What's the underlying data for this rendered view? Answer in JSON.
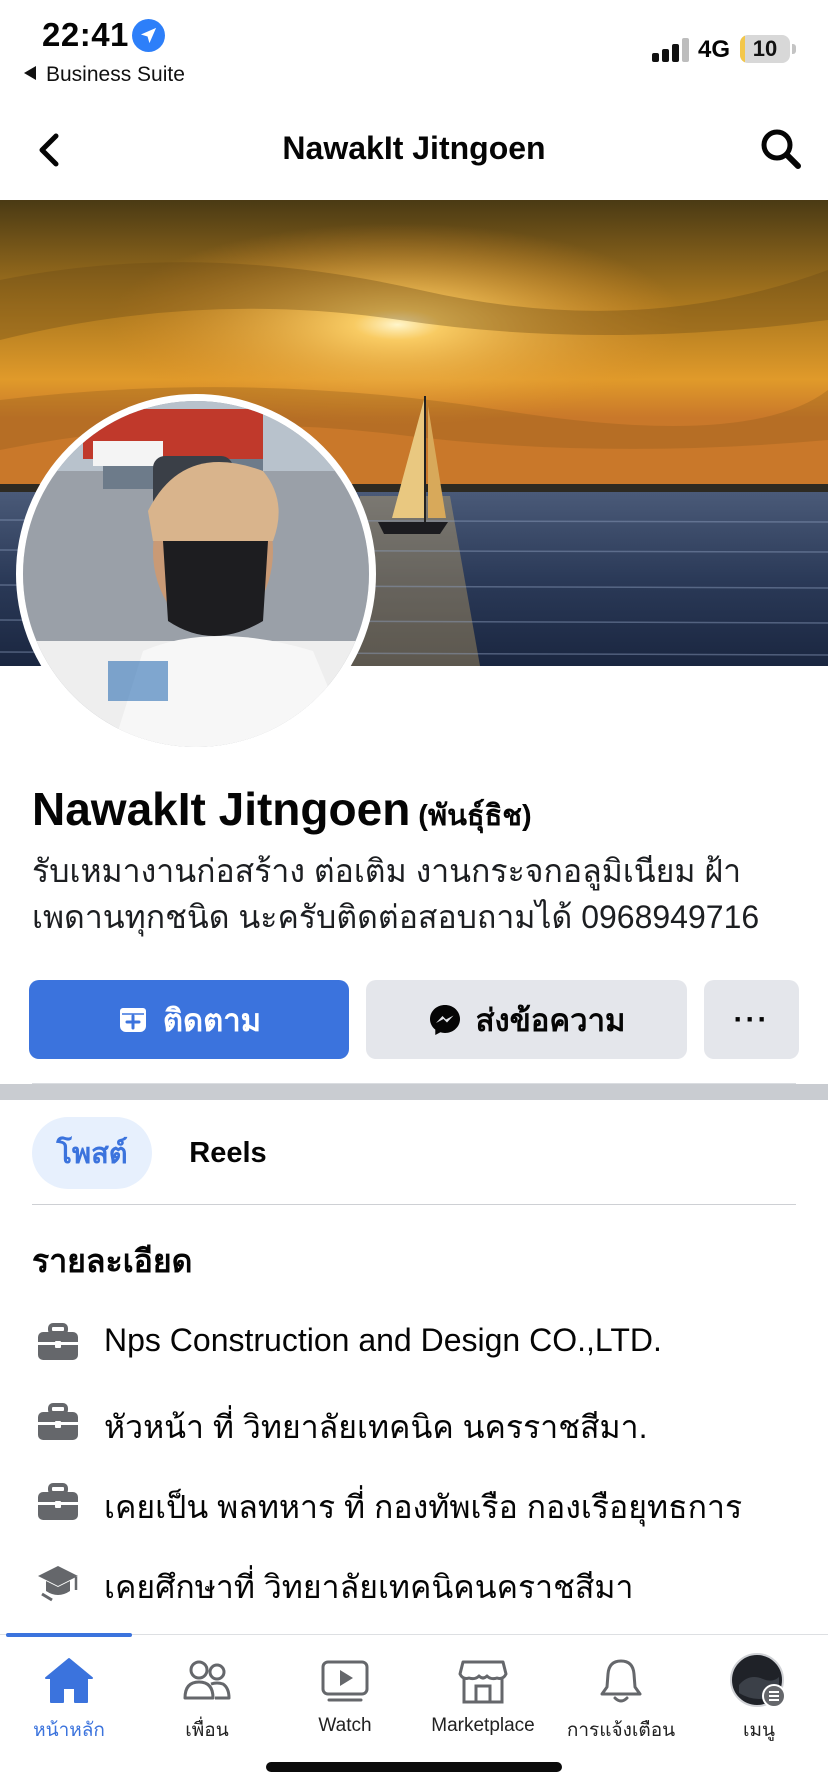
{
  "status_bar": {
    "time": "22:41",
    "back_app": "Business Suite",
    "network": "4G",
    "battery": "10",
    "battery_level": 0.1
  },
  "nav": {
    "title": "NawakIt Jitngoen"
  },
  "profile": {
    "name": "NawakIt Jitngoen",
    "alt_name": "(พันธุ์ธิช)",
    "bio_line1": "รับเหมางานก่อสร้าง ต่อเติม งานกระจกอลูมิเนียม ฝ้า",
    "bio_line2": "เพดานทุกชนิด นะครับติดต่อสอบถามได้ 0968949716"
  },
  "actions": {
    "follow": "ติดตาม",
    "message": "ส่งข้อความ",
    "more": "···"
  },
  "tabs": [
    {
      "label": "โพสต์",
      "active": true
    },
    {
      "label": "Reels",
      "active": false
    }
  ],
  "details": {
    "heading": "รายละเอียด",
    "items": [
      {
        "icon": "briefcase-icon",
        "text": "Nps Construction and Design CO.,LTD."
      },
      {
        "icon": "briefcase-icon",
        "text": "หัวหน้า ที่ วิทยาลัยเทคนิค นครราชสีมา."
      },
      {
        "icon": "briefcase-icon",
        "text": "เคยเป็น พลทหาร ที่ กองทัพเรือ กองเรือยุทธการ"
      },
      {
        "icon": "graduation-cap-icon",
        "text": "เคยศึกษาที่ วิทยาลัยเทคนิคนคราชสีมา"
      }
    ]
  },
  "tabbar": [
    {
      "label": "หน้าหลัก",
      "icon": "home-icon",
      "active": true
    },
    {
      "label": "เพื่อน",
      "icon": "friends-icon",
      "active": false
    },
    {
      "label": "Watch",
      "icon": "watch-icon",
      "active": false
    },
    {
      "label": "Marketplace",
      "icon": "marketplace-icon",
      "active": false
    },
    {
      "label": "การแจ้งเตือน",
      "icon": "bell-icon",
      "active": false
    },
    {
      "label": "เมนู",
      "icon": "menu-avatar-icon",
      "active": false
    }
  ],
  "colors": {
    "accent": "#3b73dd",
    "button_grey": "#e4e6eb",
    "tab_active_bg": "#e7f0fd"
  }
}
